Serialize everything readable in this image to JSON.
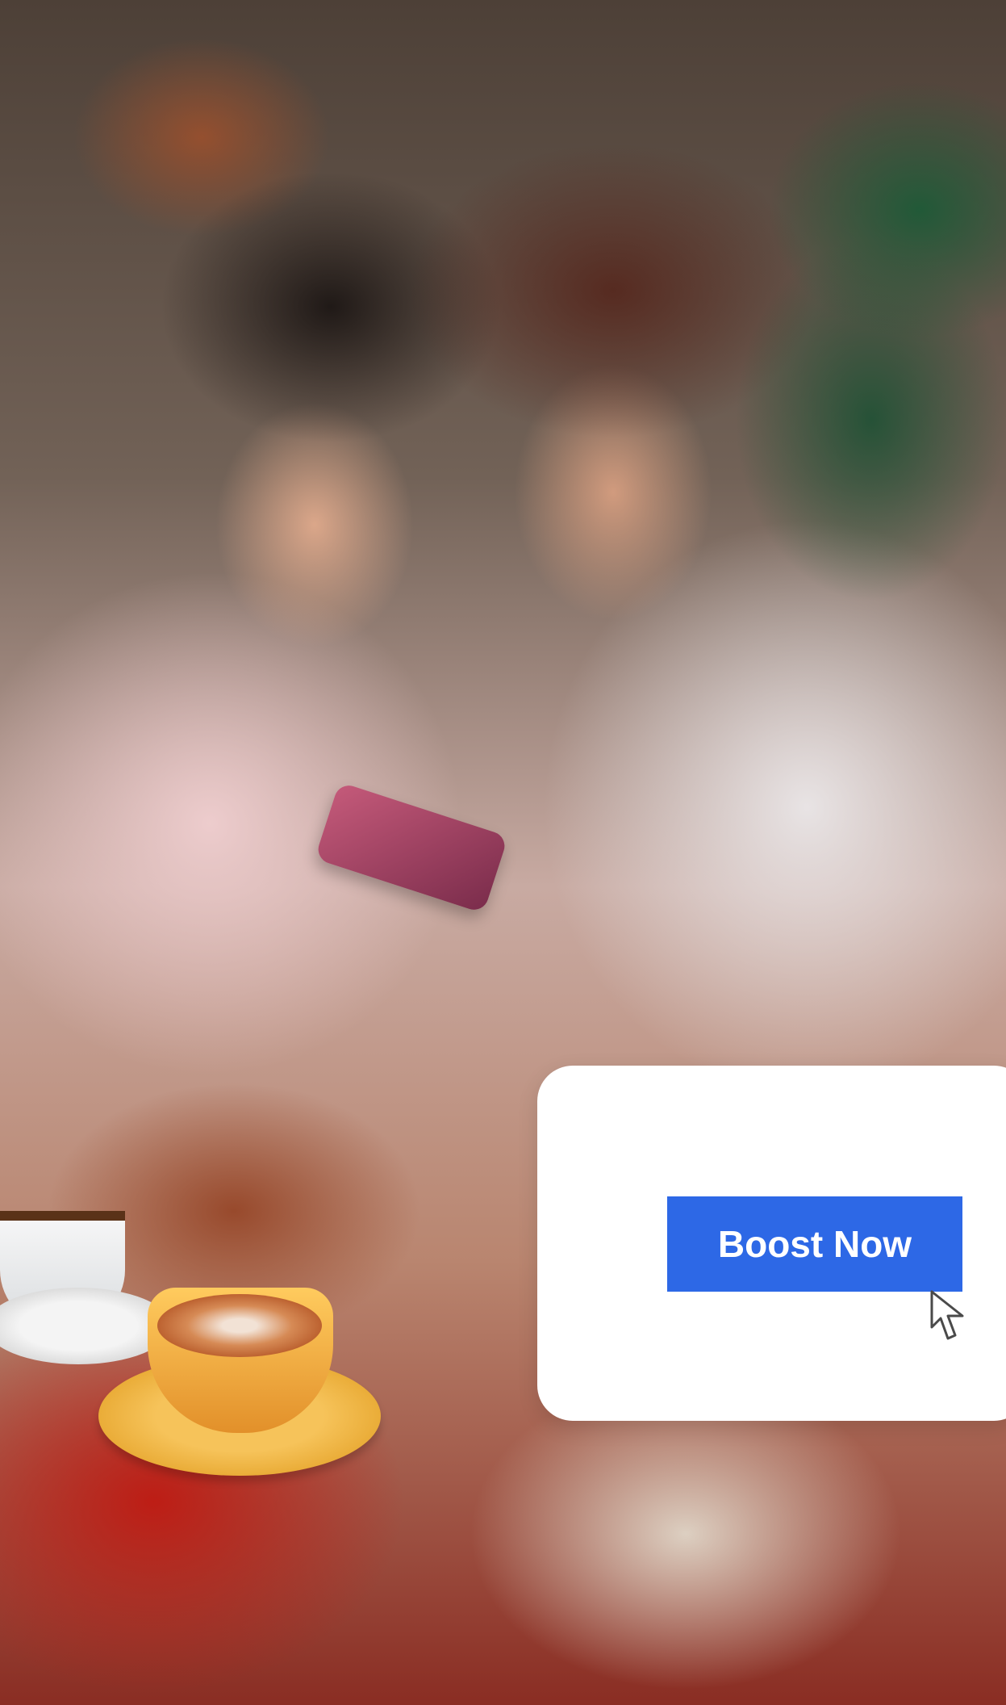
{
  "screen": {
    "background_photo_icon": "photo-icon",
    "accent_color": "#2d68e6"
  },
  "cta_card": {
    "button_label": "Boost Now",
    "cursor_icon": "cursor-arrow-icon"
  }
}
